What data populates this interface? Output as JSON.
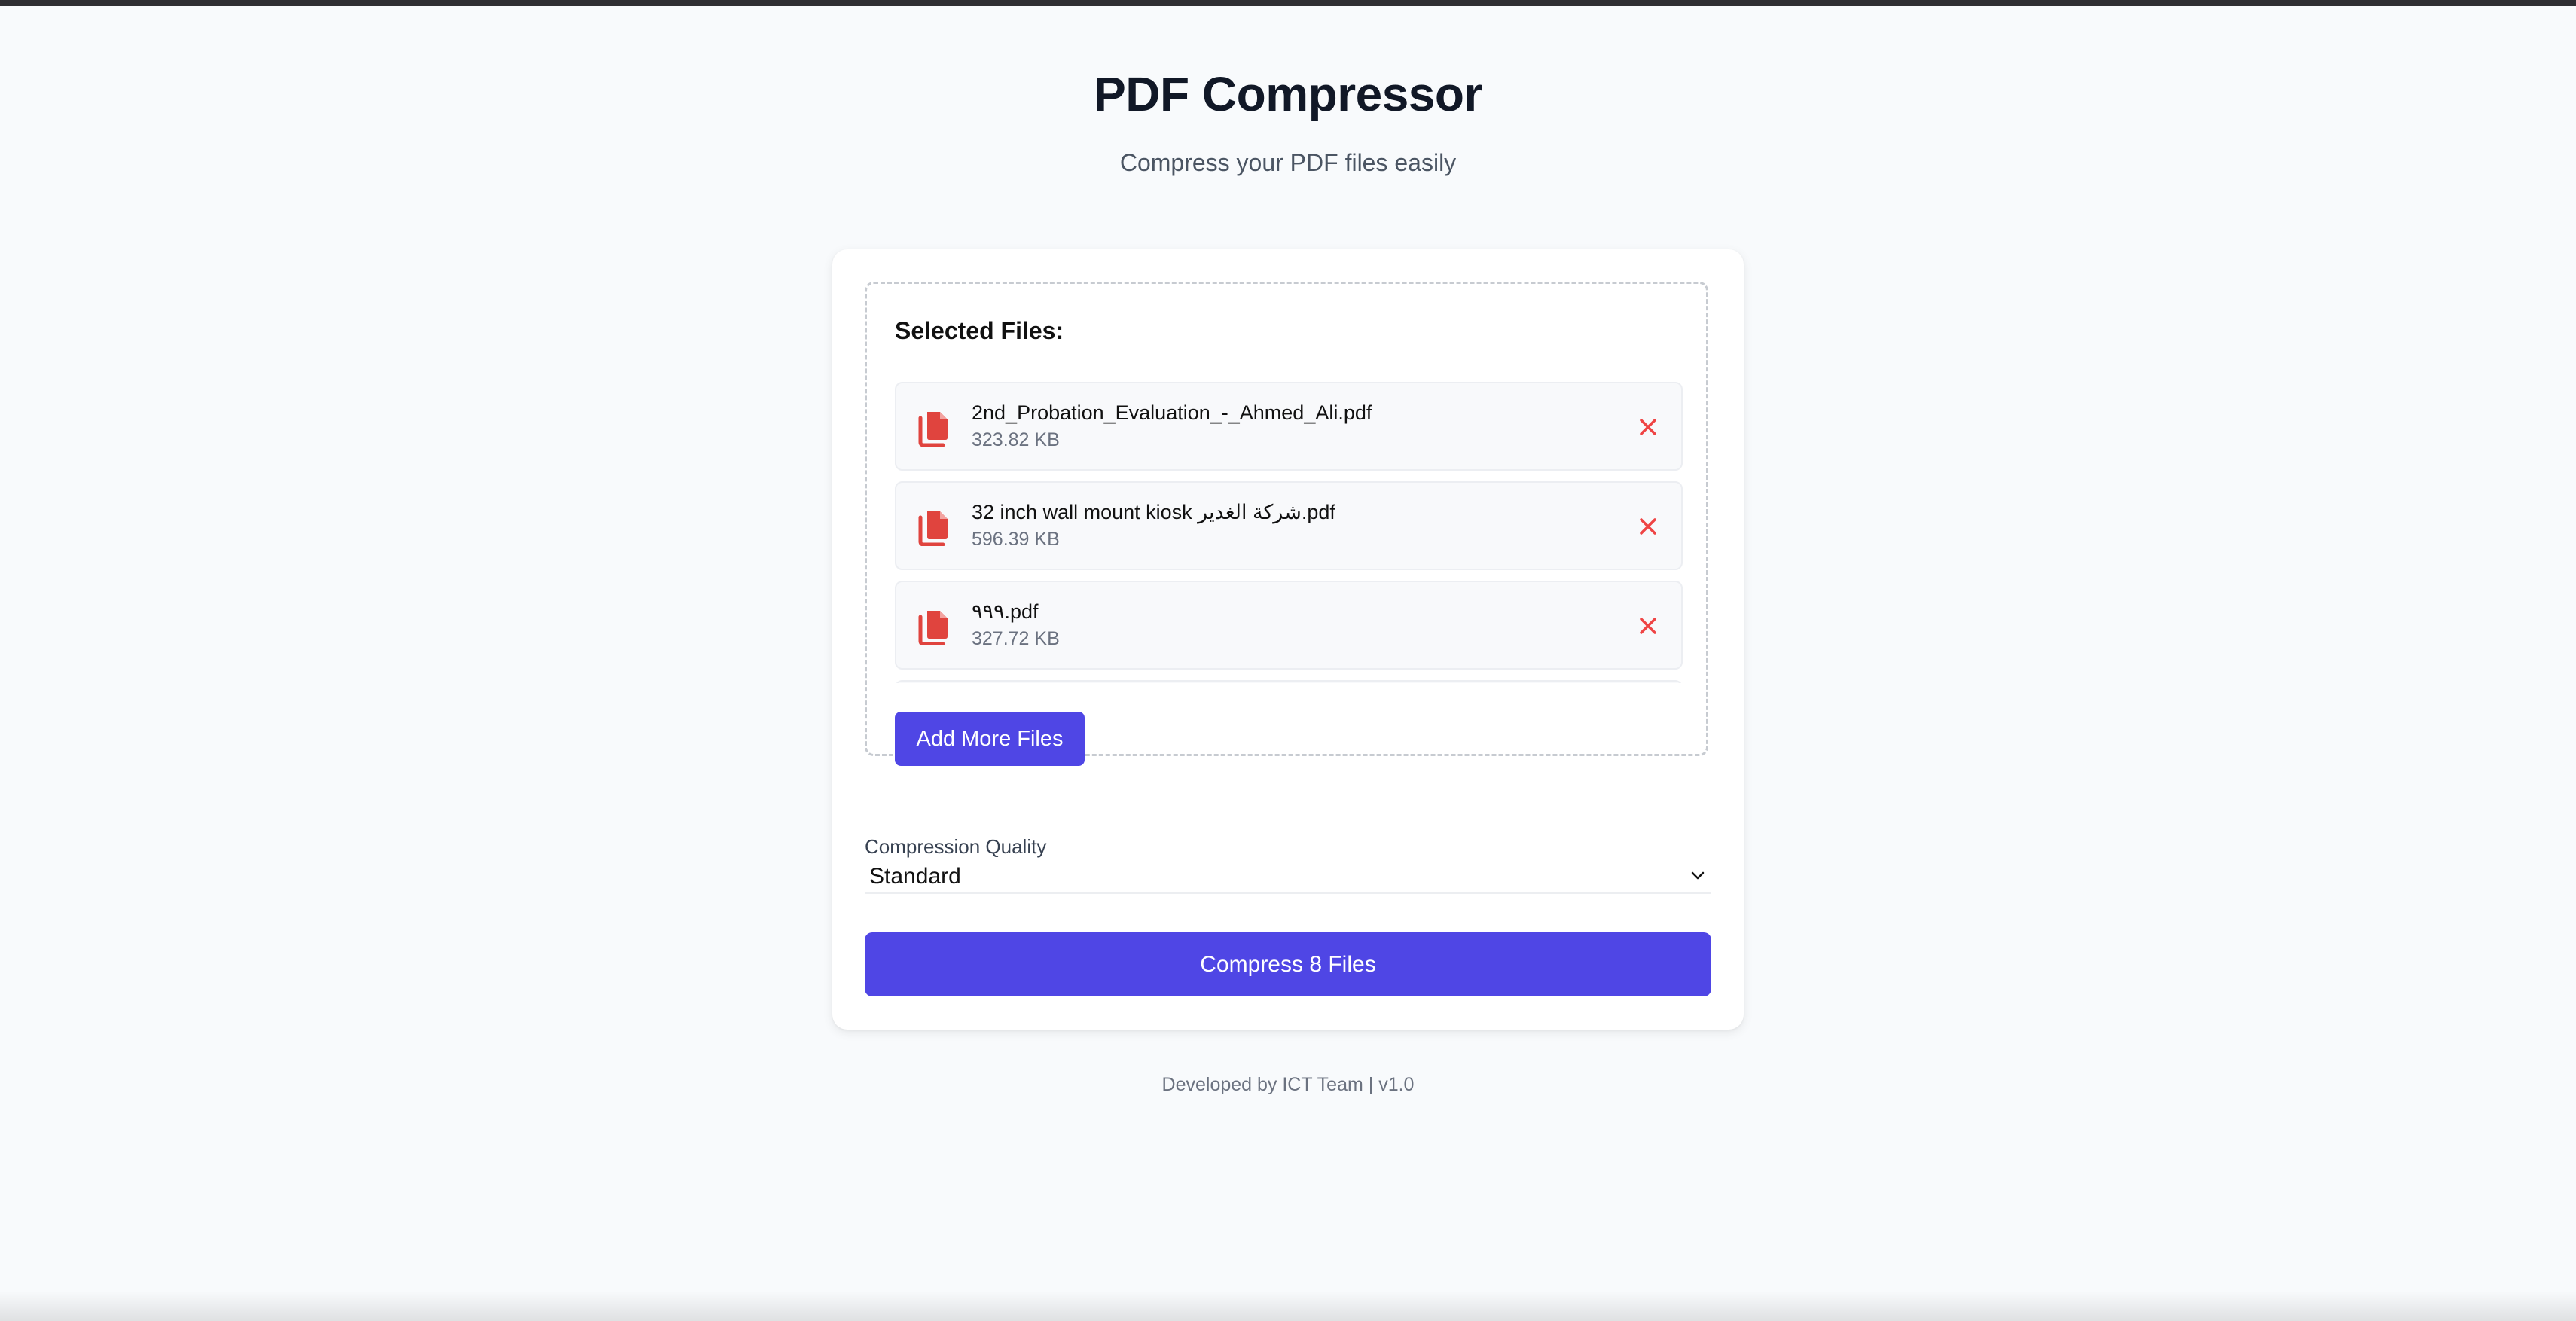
{
  "header": {
    "title": "PDF Compressor",
    "subtitle": "Compress your PDF files easily"
  },
  "files_panel": {
    "heading": "Selected Files:",
    "files": [
      {
        "name": "2nd_Probation_Evaluation_-_Ahmed_Ali.pdf",
        "size": "323.82 KB"
      },
      {
        "name": "32 inch wall mount kiosk شركة الغدير.pdf",
        "size": "596.39 KB"
      },
      {
        "name": "٩٩٩.pdf",
        "size": "327.72 KB"
      }
    ],
    "add_more_label": "Add More Files"
  },
  "quality": {
    "label": "Compression Quality",
    "selected": "Standard"
  },
  "compress_label": "Compress 8 Files",
  "footer": "Developed by ICT Team | v1.0",
  "colors": {
    "accent": "#4f46e5",
    "file_icon": "#e0443e",
    "remove_icon": "#ef4444"
  },
  "icons": {
    "file": "pdf-file-icon",
    "remove": "close-icon",
    "dropdown": "chevron-down-icon"
  }
}
